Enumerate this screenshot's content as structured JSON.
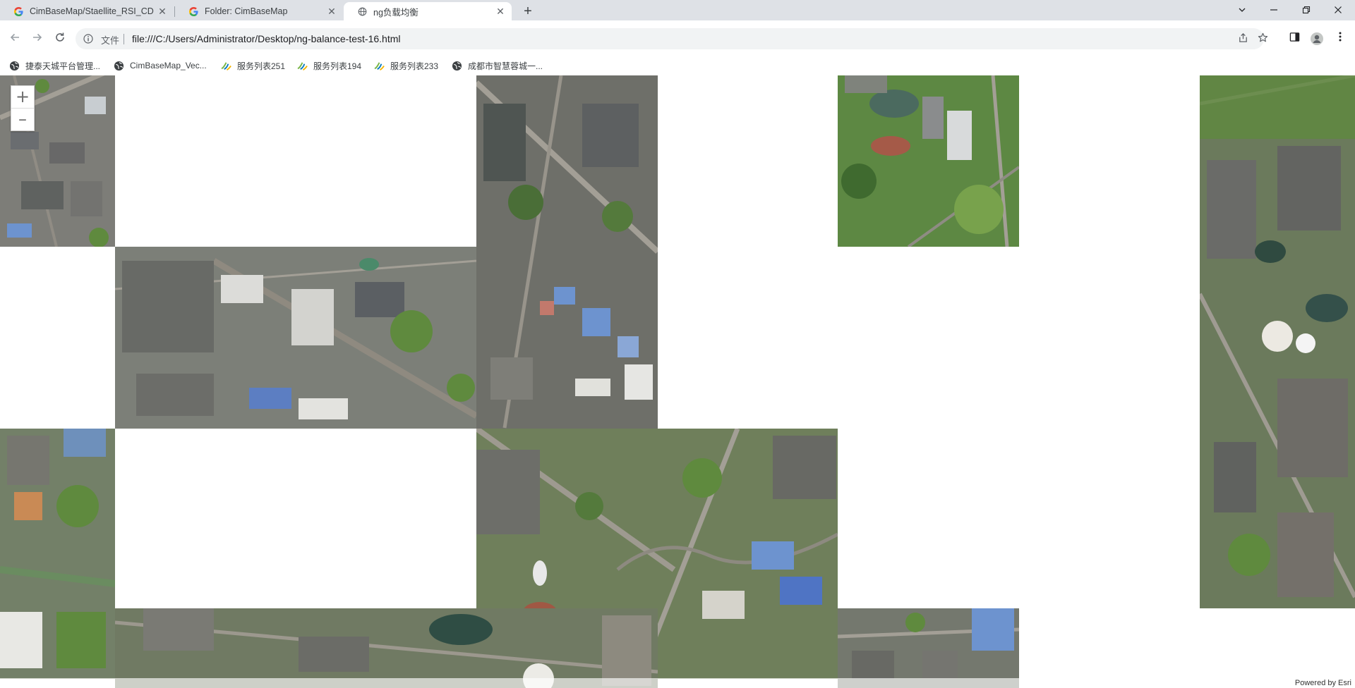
{
  "browser": {
    "tabs": [
      {
        "title": "CimBaseMap/Staellite_RSI_CD",
        "active": false,
        "favicon": "google-favicon-icon"
      },
      {
        "title": "Folder: CimBaseMap",
        "active": false,
        "favicon": "google-favicon-icon"
      },
      {
        "title": "ng负载均衡",
        "active": true,
        "favicon": "globe-icon"
      }
    ],
    "new_tab": "+",
    "window_controls": {
      "minimize": "—",
      "restore": "❐",
      "close": "✕",
      "tab_search": "⌄"
    },
    "toolbar": {
      "scheme_label": "文件",
      "url": "file:///C:/Users/Administrator/Desktop/ng-balance-test-16.html"
    },
    "bookmarks": [
      {
        "label": "捷泰天城平台管理...",
        "icon": "globe-icon"
      },
      {
        "label": "CimBaseMap_Vec...",
        "icon": "globe-icon"
      },
      {
        "label": "服务列表251",
        "icon": "arcgis-icon"
      },
      {
        "label": "服务列表194",
        "icon": "arcgis-icon"
      },
      {
        "label": "服务列表233",
        "icon": "arcgis-icon"
      },
      {
        "label": "成都市智慧蓉城一...",
        "icon": "globe-icon"
      }
    ]
  },
  "map": {
    "zoom_in": "+",
    "zoom_out": "–",
    "attribution": "Powered by Esri",
    "colors": {
      "vegetation": "#5f8a3e",
      "urban": "#7d7d78",
      "road": "#a39f96",
      "roof_blue": "#6d93cf",
      "water": "#4b6a5f"
    }
  }
}
